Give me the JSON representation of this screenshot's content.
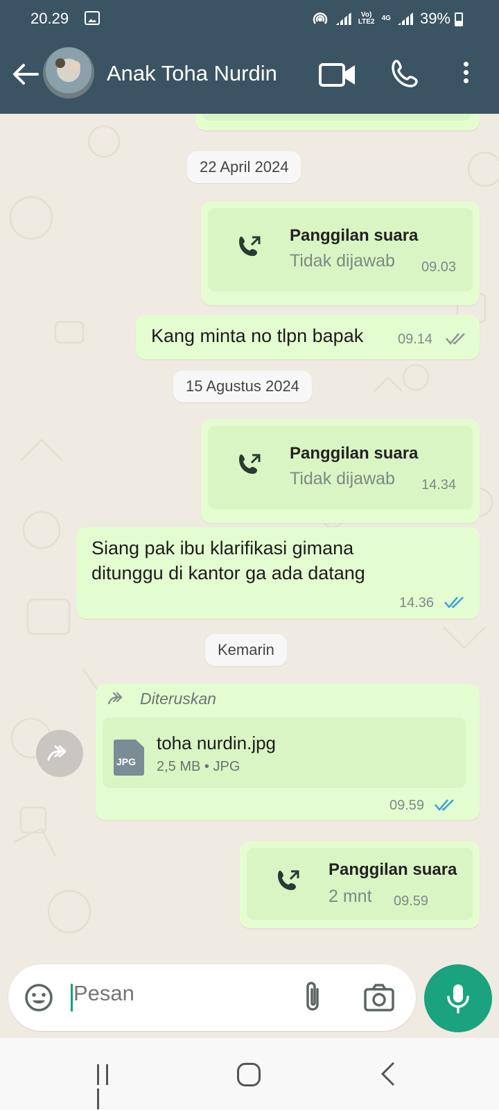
{
  "status": {
    "time": "20.29",
    "volte": "Vo) LTE2",
    "network": "4G",
    "battery": "39%"
  },
  "header": {
    "contact_name": "Anak Toha Nurdin"
  },
  "messages": [
    {
      "type": "date",
      "label": "22 April 2024"
    },
    {
      "type": "call",
      "title": "Panggilan suara",
      "subtitle": "Tidak dijawab",
      "time": "09.03"
    },
    {
      "type": "text",
      "text": "Kang minta no tlpn bapak",
      "time": "09.14",
      "status": "delivered"
    },
    {
      "type": "date",
      "label": "15 Agustus 2024"
    },
    {
      "type": "call",
      "title": "Panggilan suara",
      "subtitle": "Tidak dijawab",
      "time": "14.34"
    },
    {
      "type": "text",
      "text": "Siang pak ibu klarifikasi  gimana ditunggu di kantor ga ada datang",
      "time": "14.36",
      "status": "read"
    },
    {
      "type": "date",
      "label": "Kemarin"
    },
    {
      "type": "file",
      "forwarded_label": "Diteruskan",
      "file_name": "toha nurdin.jpg",
      "file_badge": "JPG",
      "file_meta": "2,5 MB • JPG",
      "time": "09.59",
      "status": "read"
    },
    {
      "type": "call",
      "title": "Panggilan suara",
      "subtitle": "2 mnt",
      "time": "09.59"
    }
  ],
  "composer": {
    "placeholder": "Pesan"
  },
  "colors": {
    "header_bg": "#3b5463",
    "outgoing_bubble": "#e4fdd0",
    "read_tick": "#34a3e0",
    "accent": "#1aa37e"
  }
}
